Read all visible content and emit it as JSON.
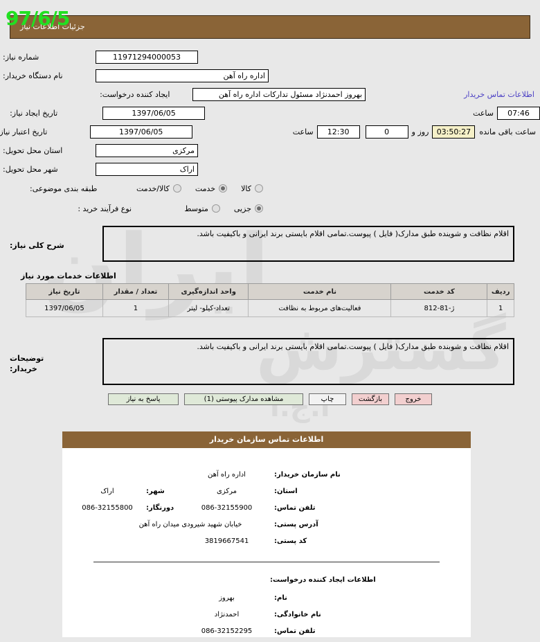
{
  "stamp": "97/6/5",
  "header": {
    "title": "جزئیات اطلاعات نیاز"
  },
  "form": {
    "need_number_label": "شماره نیاز:",
    "need_number": "11971294000053",
    "buyer_org_label": "نام دستگاه خریدار:",
    "buyer_org": "اداره راه آهن",
    "creator_label": "ایجاد کننده درخواست:",
    "creator": "بهروز احمدنژاد مسئول تدارکات اداره راه آهن",
    "contact_link": "اطلاعات تماس خریدار",
    "create_date_label": "تاریخ ایجاد نیاز:",
    "create_date": "1397/06/05",
    "create_time_label": "ساعت",
    "create_time": "07:46",
    "expire_date_label": "تاریخ اعتبار نیاز:",
    "expire_date": "1397/06/05",
    "expire_time_label": "ساعت",
    "expire_time": "12:30",
    "remaining_days": "0",
    "remaining_days_label": "روز و",
    "countdown": "03:50:27",
    "remaining_suffix": "ساعت باقی مانده",
    "province_label": "استان محل تحویل:",
    "province": "مرکزی",
    "city_label": "شهر محل تحویل:",
    "city": "اراک",
    "category_label": "طبقه بندی موضوعی:",
    "category_options": [
      {
        "label": "کالا",
        "selected": false
      },
      {
        "label": "خدمت",
        "selected": true
      },
      {
        "label": "کالا/خدمت",
        "selected": false
      }
    ],
    "process_label": "نوع فرآیند خرید :",
    "process_options": [
      {
        "label": "جزیی",
        "selected": true
      },
      {
        "label": "متوسط",
        "selected": false
      }
    ]
  },
  "description": {
    "label": "شرح کلی نیاز:",
    "text": "اقلام نظافت و شوینده طبق مدارک( فایل ) پیوست.تمامی اقلام بایستی برند ایرانی و باکیفیت باشد."
  },
  "services": {
    "heading": "اطلاعات خدمات مورد نیاز",
    "columns": [
      "ردیف",
      "کد خدمت",
      "نام خدمت",
      "واحد اندازه‌گیری",
      "تعداد / مقدار",
      "تاریخ نیاز"
    ],
    "rows": [
      [
        "1",
        "ژ-81-812",
        "فعالیت‌های مربوط به نظافت",
        "تعداد-کیلو- لیتر",
        "1",
        "1397/06/05"
      ]
    ]
  },
  "notes": {
    "label_line1": "توضیحات",
    "label_line2": "خریدار:",
    "text": "اقلام نظافت و شوبنده طبق مدارک( فایل ) پیوست.تمامی اقلام بایستی برند ایرانی و باکیفیت باشد."
  },
  "buttons": {
    "answer": "پاسخ به نیاز",
    "documents": "مشاهده مدارک پیوستی (1)",
    "print": "چاپ",
    "back": "بازگشت",
    "exit": "خروج"
  },
  "contact_panel": {
    "title": "اطلاعات تماس سازمان خریدار",
    "org_label": "نام سازمان خریدار:",
    "org": "اداره راه آهن",
    "province_label": "استان:",
    "province": "مرکزی",
    "city_label": "شهر:",
    "city": "اراک",
    "phone_label": "تلفن تماس:",
    "phone": "086-32155900",
    "fax_label": "دورنگار:",
    "fax": "086-32155800",
    "address_label": "آدرس پستی:",
    "address": "خیابان شهید شیرودی میدان راه آهن",
    "postal_label": "کد پستی:",
    "postal": "3819667541",
    "requester_title": "اطلاعات ایجاد کننده درخواست:",
    "first_name_label": "نام:",
    "first_name": "بهروز",
    "last_name_label": "نام خانوادگی:",
    "last_name": "احمدنژاد",
    "req_phone_label": "تلفن تماس:",
    "req_phone": "086-32152295"
  },
  "colors": {
    "brand": "#8a6437",
    "stamp": "#22e022",
    "link": "#4a3fc4",
    "countdown_bg": "#f5f0c8",
    "green_btn": "#dfe9d8",
    "pink_btn": "#f2cfcf"
  },
  "watermark": {
    "text1": "ایران",
    "text2": "گسترش",
    "text3": "ا.ج.ا"
  }
}
